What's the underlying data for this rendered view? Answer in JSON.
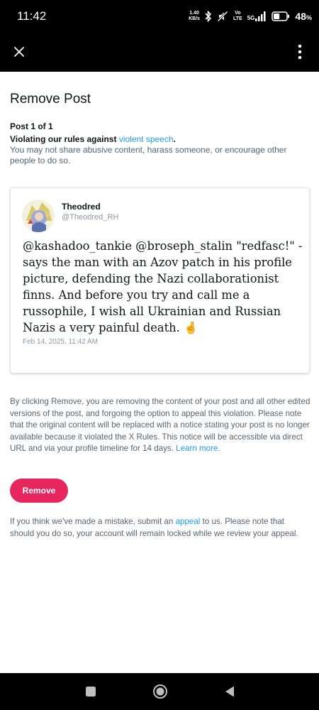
{
  "status_bar": {
    "time": "11:42",
    "net_speed_value": "1.40",
    "net_speed_unit": "KB/s",
    "volte_top": "Vo",
    "volte_bottom": "LTE",
    "network": "5G",
    "battery_percent": "48",
    "battery_unit": "%",
    "battery_level": 0.48
  },
  "app_bar": {
    "close_label": "X"
  },
  "page": {
    "title": "Remove Post",
    "post_count": "Post 1 of 1",
    "violation_prefix": "Violating our rules against ",
    "violation_link": "violent speech",
    "violation_suffix": ".",
    "violation_desc": "You may not share abusive content, harass someone, or encourage other people to do so."
  },
  "post": {
    "author_name": "Theodred",
    "author_handle": "@Theodred_RH",
    "text": "@kashadoo_tankie @broseph_stalin \"redfasc!\" - says the man with an Azov patch in his profile picture, defending the Nazi collaborationist finns. And before you try and call me a russophile, I wish all Ukrainian and Russian Nazis a very painful death. 🤞",
    "date": "Feb 14, 2025, 11:42 AM"
  },
  "explanation": {
    "text": "By clicking Remove, you are removing the content of your post and all other edited versions of the post, and forgoing the option to appeal this violation. Please note that the original content will be replaced with a notice stating your post is no longer available because it violated the X Rules. This notice will be accessible via direct URL and via your profile timeline for 14 days. ",
    "learn_more": "Learn more",
    "learn_more_suffix": "."
  },
  "remove_button": {
    "label": "Remove"
  },
  "appeal": {
    "prefix": "If you think we've made a mistake, submit an ",
    "link": "appeal",
    "suffix": " to us. Please note that should you do so, your account will remain locked while we review your appeal."
  },
  "colors": {
    "accent_link": "#1d9bf0",
    "remove_button": "#e8265e",
    "bar_background": "#000000"
  },
  "icons": {
    "bluetooth": "bluetooth-icon",
    "mute": "mute-icon",
    "signal": "signal-icon",
    "battery": "battery-icon",
    "more": "more-vertical-icon",
    "nav_recents": "square-icon",
    "nav_home": "circle-icon",
    "nav_back": "triangle-back-icon"
  }
}
